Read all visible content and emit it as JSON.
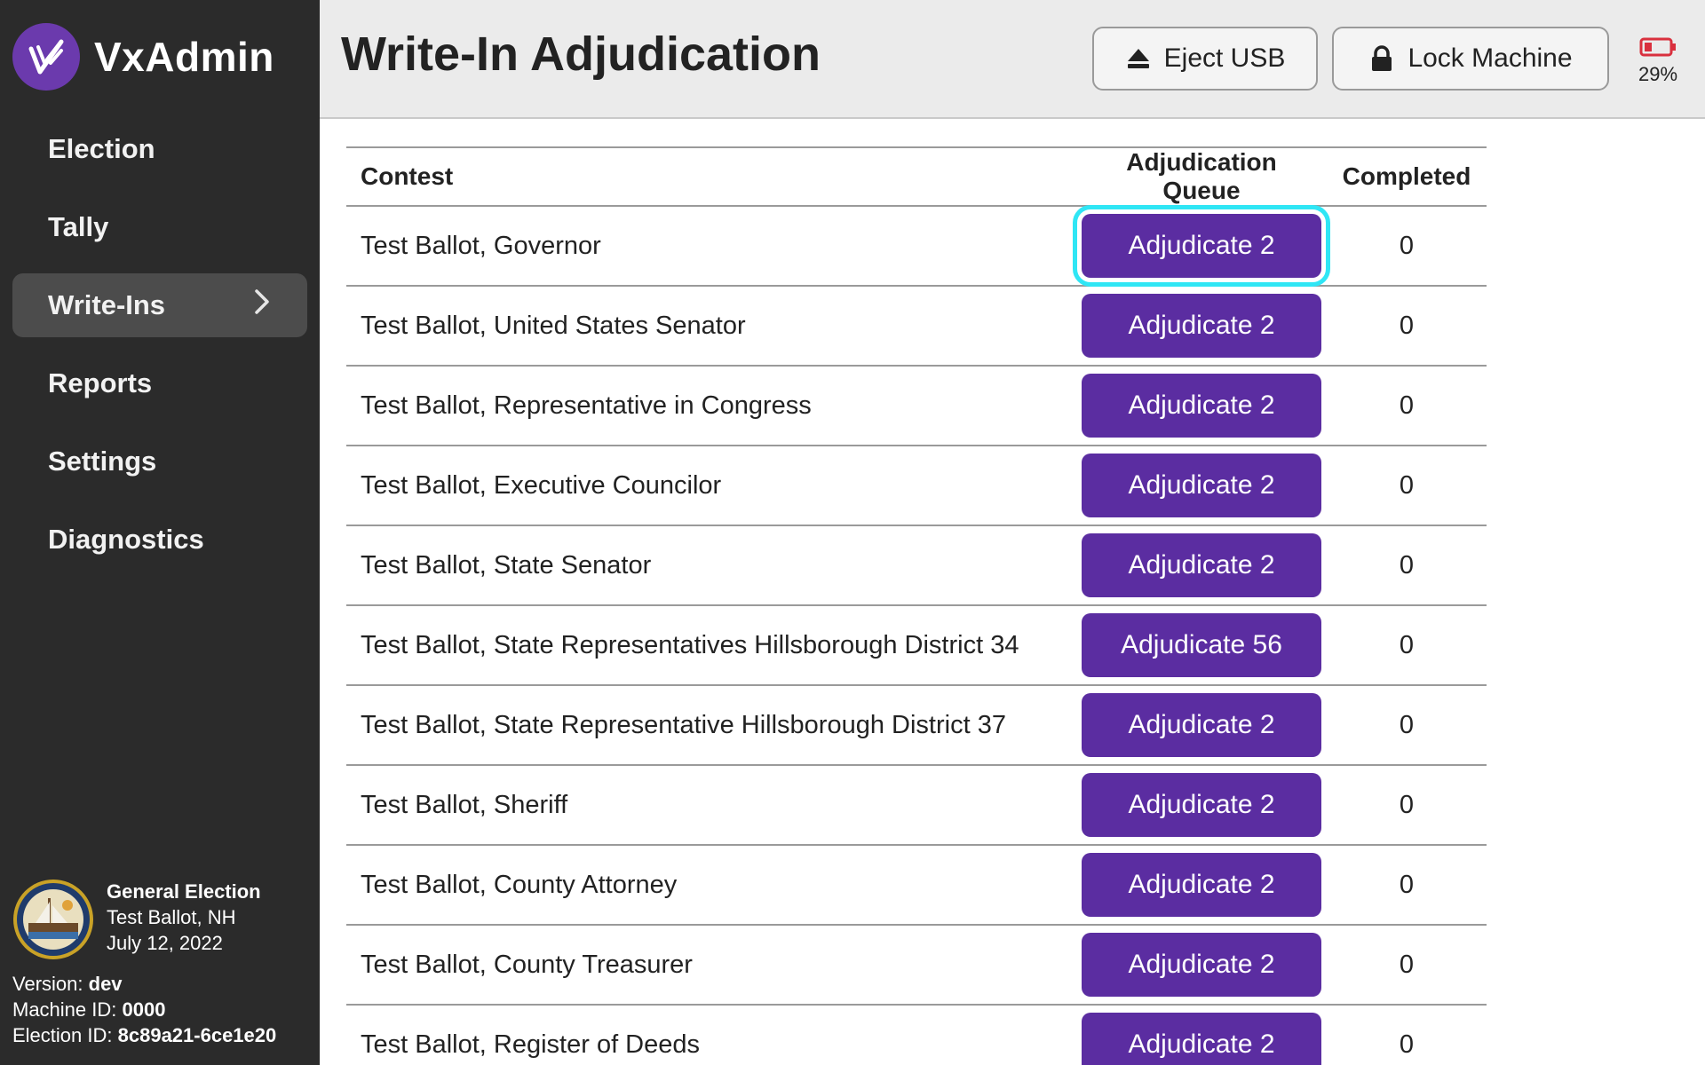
{
  "app": {
    "name": "VxAdmin"
  },
  "nav": {
    "items": [
      {
        "label": "Election",
        "active": false
      },
      {
        "label": "Tally",
        "active": false
      },
      {
        "label": "Write-Ins",
        "active": true
      },
      {
        "label": "Reports",
        "active": false
      },
      {
        "label": "Settings",
        "active": false
      },
      {
        "label": "Diagnostics",
        "active": false
      }
    ]
  },
  "election": {
    "title": "General Election",
    "location": "Test Ballot, NH",
    "date": "July 12, 2022"
  },
  "meta": {
    "version_label": "Version:",
    "version": "dev",
    "machine_label": "Machine ID:",
    "machine_id": "0000",
    "election_label": "Election ID:",
    "election_id": "8c89a21-6ce1e20"
  },
  "header": {
    "title": "Write-In Adjudication",
    "eject_label": "Eject USB",
    "lock_label": "Lock Machine",
    "battery": "29%"
  },
  "table": {
    "headers": {
      "contest": "Contest",
      "queue": "Adjudication Queue",
      "completed": "Completed"
    },
    "rows": [
      {
        "contest": "Test Ballot, Governor",
        "button": "Adjudicate 2",
        "completed": "0"
      },
      {
        "contest": "Test Ballot, United States Senator",
        "button": "Adjudicate 2",
        "completed": "0"
      },
      {
        "contest": "Test Ballot, Representative in Congress",
        "button": "Adjudicate 2",
        "completed": "0"
      },
      {
        "contest": "Test Ballot, Executive Councilor",
        "button": "Adjudicate 2",
        "completed": "0"
      },
      {
        "contest": "Test Ballot, State Senator",
        "button": "Adjudicate 2",
        "completed": "0"
      },
      {
        "contest": "Test Ballot, State Representatives Hillsborough District 34",
        "button": "Adjudicate 56",
        "completed": "0"
      },
      {
        "contest": "Test Ballot, State Representative Hillsborough District 37",
        "button": "Adjudicate 2",
        "completed": "0"
      },
      {
        "contest": "Test Ballot, Sheriff",
        "button": "Adjudicate 2",
        "completed": "0"
      },
      {
        "contest": "Test Ballot, County Attorney",
        "button": "Adjudicate 2",
        "completed": "0"
      },
      {
        "contest": "Test Ballot, County Treasurer",
        "button": "Adjudicate 2",
        "completed": "0"
      },
      {
        "contest": "Test Ballot, Register of Deeds",
        "button": "Adjudicate 2",
        "completed": "0"
      }
    ]
  },
  "colors": {
    "accent": "#5b2da1",
    "focus": "#2fe6f5",
    "sidebar": "#2b2b2b",
    "battery_low": "#d9303e"
  },
  "icons": {
    "logo": "vx-logo-icon",
    "eject": "eject-icon",
    "lock": "lock-icon",
    "battery": "battery-low-icon",
    "chevron": "chevron-right-icon",
    "seal": "state-seal-icon"
  }
}
